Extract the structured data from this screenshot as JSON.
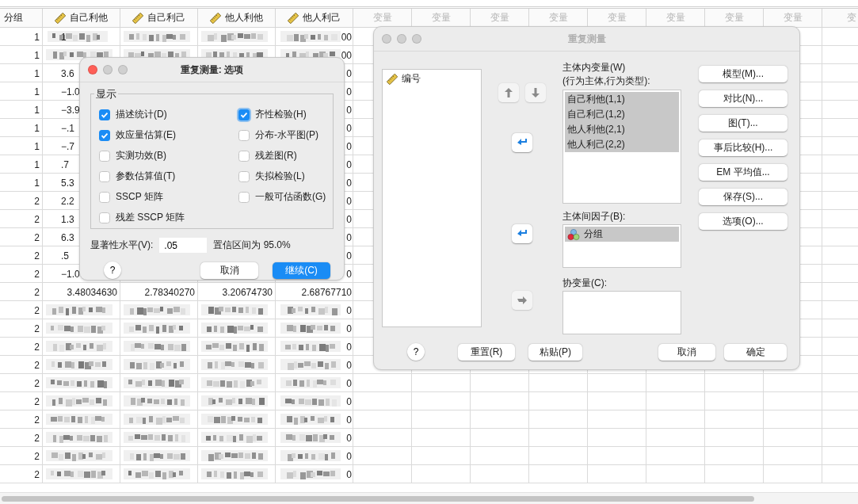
{
  "sheet": {
    "columns": [
      {
        "label": "分组",
        "kind": "plain"
      },
      {
        "label": "自己利他",
        "kind": "scale"
      },
      {
        "label": "自己利己",
        "kind": "scale"
      },
      {
        "label": "他人利他",
        "kind": "scale"
      },
      {
        "label": "他人利己",
        "kind": "scale"
      },
      {
        "label": "变量",
        "kind": "empty"
      },
      {
        "label": "变量",
        "kind": "empty"
      },
      {
        "label": "变量",
        "kind": "empty"
      },
      {
        "label": "变量",
        "kind": "empty"
      },
      {
        "label": "变量",
        "kind": "empty"
      },
      {
        "label": "变量",
        "kind": "empty"
      },
      {
        "label": "变量",
        "kind": "empty"
      },
      {
        "label": "变量",
        "kind": "empty"
      },
      {
        "label": "变",
        "kind": "empty"
      }
    ],
    "rows": [
      {
        "cells": [
          {
            "kind": "text",
            "text": "1"
          },
          {
            "kind": "blurred",
            "text": "1"
          },
          {
            "kind": "blurred"
          },
          {
            "kind": "blurred"
          },
          {
            "kind": "blurred",
            "text": "00"
          }
        ]
      },
      {
        "cells": [
          {
            "kind": "text",
            "text": "1"
          },
          {
            "kind": "blurred"
          },
          {
            "kind": "blurred"
          },
          {
            "kind": "blurred"
          },
          {
            "kind": "blurred",
            "text": "00"
          }
        ]
      },
      {
        "cells": [
          {
            "kind": "text",
            "text": "1"
          },
          {
            "kind": "head",
            "text": "3.6"
          },
          {
            "kind": "covered"
          },
          {
            "kind": "covered"
          },
          {
            "kind": "tail",
            "text": "0"
          }
        ]
      },
      {
        "cells": [
          {
            "kind": "text",
            "text": "1"
          },
          {
            "kind": "head",
            "text": "−1.0"
          },
          {
            "kind": "covered"
          },
          {
            "kind": "covered"
          },
          {
            "kind": "tail",
            "text": "0"
          }
        ]
      },
      {
        "cells": [
          {
            "kind": "text",
            "text": "1"
          },
          {
            "kind": "head",
            "text": "−3.9"
          },
          {
            "kind": "covered"
          },
          {
            "kind": "covered"
          },
          {
            "kind": "tail",
            "text": "0"
          }
        ]
      },
      {
        "cells": [
          {
            "kind": "text",
            "text": "1"
          },
          {
            "kind": "head",
            "text": "−.1"
          },
          {
            "kind": "covered"
          },
          {
            "kind": "covered"
          },
          {
            "kind": "tail",
            "text": "0"
          }
        ]
      },
      {
        "cells": [
          {
            "kind": "text",
            "text": "1"
          },
          {
            "kind": "head",
            "text": "−.7"
          },
          {
            "kind": "covered"
          },
          {
            "kind": "covered"
          },
          {
            "kind": "tail",
            "text": "0"
          }
        ]
      },
      {
        "cells": [
          {
            "kind": "text",
            "text": "1"
          },
          {
            "kind": "head",
            "text": ".7"
          },
          {
            "kind": "covered"
          },
          {
            "kind": "covered"
          },
          {
            "kind": "tail",
            "text": "0"
          }
        ]
      },
      {
        "cells": [
          {
            "kind": "text",
            "text": "1"
          },
          {
            "kind": "head",
            "text": "5.3"
          },
          {
            "kind": "covered"
          },
          {
            "kind": "covered"
          },
          {
            "kind": "tail",
            "text": "0"
          }
        ]
      },
      {
        "cells": [
          {
            "kind": "text",
            "text": "2"
          },
          {
            "kind": "head",
            "text": "2.2"
          },
          {
            "kind": "covered"
          },
          {
            "kind": "covered"
          },
          {
            "kind": "tail",
            "text": "0"
          }
        ]
      },
      {
        "cells": [
          {
            "kind": "text",
            "text": "2"
          },
          {
            "kind": "head",
            "text": "1.3"
          },
          {
            "kind": "covered"
          },
          {
            "kind": "covered"
          },
          {
            "kind": "tail",
            "text": "0"
          }
        ]
      },
      {
        "cells": [
          {
            "kind": "text",
            "text": "2"
          },
          {
            "kind": "head",
            "text": "6.3"
          },
          {
            "kind": "covered"
          },
          {
            "kind": "covered"
          },
          {
            "kind": "tail",
            "text": "0"
          }
        ]
      },
      {
        "cells": [
          {
            "kind": "text",
            "text": "2"
          },
          {
            "kind": "head",
            "text": ".5"
          },
          {
            "kind": "covered"
          },
          {
            "kind": "covered"
          },
          {
            "kind": "tail",
            "text": "0"
          }
        ]
      },
      {
        "cells": [
          {
            "kind": "text",
            "text": "2"
          },
          {
            "kind": "head",
            "text": "−1.0"
          },
          {
            "kind": "covered"
          },
          {
            "kind": "covered"
          },
          {
            "kind": "tail",
            "text": "0"
          }
        ]
      },
      {
        "cells": [
          {
            "kind": "text",
            "text": "2"
          },
          {
            "kind": "text",
            "text": "3.48034630"
          },
          {
            "kind": "text",
            "text": "2.78340270"
          },
          {
            "kind": "text",
            "text": "3.20674730"
          },
          {
            "kind": "text",
            "text": "2.68767710"
          }
        ]
      },
      {
        "cells": [
          {
            "kind": "text",
            "text": "2"
          },
          {
            "kind": "blurred"
          },
          {
            "kind": "blurred"
          },
          {
            "kind": "blurred"
          },
          {
            "kind": "blurred",
            "text": "0"
          }
        ]
      },
      {
        "cells": [
          {
            "kind": "text",
            "text": "2"
          },
          {
            "kind": "blurred"
          },
          {
            "kind": "blurred"
          },
          {
            "kind": "blurred"
          },
          {
            "kind": "blurred",
            "text": "0"
          }
        ]
      },
      {
        "cells": [
          {
            "kind": "text",
            "text": "2"
          },
          {
            "kind": "blurred"
          },
          {
            "kind": "blurred"
          },
          {
            "kind": "blurred"
          },
          {
            "kind": "blurred",
            "text": "0"
          }
        ]
      },
      {
        "cells": [
          {
            "kind": "text",
            "text": "2"
          },
          {
            "kind": "blurred"
          },
          {
            "kind": "blurred"
          },
          {
            "kind": "blurred"
          },
          {
            "kind": "blurred",
            "text": "0"
          }
        ]
      },
      {
        "cells": [
          {
            "kind": "text",
            "text": "2"
          },
          {
            "kind": "blurred"
          },
          {
            "kind": "blurred"
          },
          {
            "kind": "blurred"
          },
          {
            "kind": "blurred",
            "text": "0"
          }
        ]
      },
      {
        "cells": [
          {
            "kind": "text",
            "text": "2"
          },
          {
            "kind": "blurred"
          },
          {
            "kind": "blurred"
          },
          {
            "kind": "blurred"
          },
          {
            "kind": "blurred",
            "text": "0"
          }
        ]
      },
      {
        "cells": [
          {
            "kind": "text",
            "text": "2"
          },
          {
            "kind": "blurred"
          },
          {
            "kind": "blurred"
          },
          {
            "kind": "blurred"
          },
          {
            "kind": "blurred",
            "text": "0"
          }
        ]
      },
      {
        "cells": [
          {
            "kind": "text",
            "text": "2"
          },
          {
            "kind": "blurred"
          },
          {
            "kind": "blurred"
          },
          {
            "kind": "blurred"
          },
          {
            "kind": "blurred",
            "text": "0"
          }
        ]
      },
      {
        "cells": [
          {
            "kind": "text",
            "text": "2"
          },
          {
            "kind": "blurred"
          },
          {
            "kind": "blurred"
          },
          {
            "kind": "blurred"
          },
          {
            "kind": "blurred",
            "text": "0"
          }
        ]
      },
      {
        "cells": [
          {
            "kind": "text",
            "text": "2"
          },
          {
            "kind": "blurred"
          },
          {
            "kind": "blurred"
          },
          {
            "kind": "blurred"
          },
          {
            "kind": "blurred",
            "text": "0"
          }
        ]
      }
    ]
  },
  "repeated_measures_dialog": {
    "title": "重复测量",
    "active": false,
    "source_list": [
      {
        "label": "编号",
        "kind": "scale",
        "selected": false
      }
    ],
    "order_buttons": [
      {
        "kind": "up",
        "disabled": true
      },
      {
        "kind": "down",
        "disabled": true
      }
    ],
    "within_label": "主体内变量(W)",
    "within_sublabel": "(行为主体,行为类型):",
    "within_items": [
      {
        "label": "自己利他(1,1)",
        "selected": true
      },
      {
        "label": "自己利己(1,2)",
        "selected": true
      },
      {
        "label": "他人利他(2,1)",
        "selected": true
      },
      {
        "label": "他人利己(2,2)",
        "selected": true
      }
    ],
    "within_move": {
      "disabled": false
    },
    "between_label": "主体间因子(B):",
    "between_items": [
      {
        "label": "分组",
        "kind": "nominal",
        "selected": true
      }
    ],
    "between_move": {
      "disabled": false
    },
    "covariate_label": "协变量(C):",
    "covariate_move": {
      "disabled": true
    },
    "side_buttons": [
      "模型(M)...",
      "对比(N)...",
      "图(T)...",
      "事后比较(H)...",
      "EM 平均值...",
      "保存(S)...",
      "选项(O)..."
    ],
    "help": "?",
    "footer_left": [
      "重置(R)",
      "粘贴(P)"
    ],
    "footer_right": [
      "取消",
      "确定"
    ]
  },
  "options_dialog": {
    "title": "重复测量: 选项",
    "active": true,
    "group_label": "显示",
    "checkboxes": [
      {
        "label": "描述统计(D)",
        "checked": true,
        "focused": false
      },
      {
        "label": "齐性检验(H)",
        "checked": true,
        "focused": true
      },
      {
        "label": "效应量估算(E)",
        "checked": true,
        "focused": false
      },
      {
        "label": "分布-水平图(P)",
        "checked": false,
        "focused": false
      },
      {
        "label": "实测功效(B)",
        "checked": false,
        "focused": false
      },
      {
        "label": "残差图(R)",
        "checked": false,
        "focused": false
      },
      {
        "label": "参数估算值(T)",
        "checked": false,
        "focused": false
      },
      {
        "label": "失拟检验(L)",
        "checked": false,
        "focused": false
      },
      {
        "label": "SSCP 矩阵",
        "checked": false,
        "focused": false
      },
      {
        "label": "一般可估函数(G)",
        "checked": false,
        "focused": false
      },
      {
        "label": "残差 SSCP 矩阵",
        "checked": false,
        "focused": false
      }
    ],
    "significance_label": "显著性水平(V):",
    "significance_value": ".05",
    "confidence_text": "置信区间为 95.0%",
    "help": "?",
    "buttons": [
      {
        "label": "取消",
        "default": false
      },
      {
        "label": "继续(C)",
        "default": true
      }
    ]
  }
}
